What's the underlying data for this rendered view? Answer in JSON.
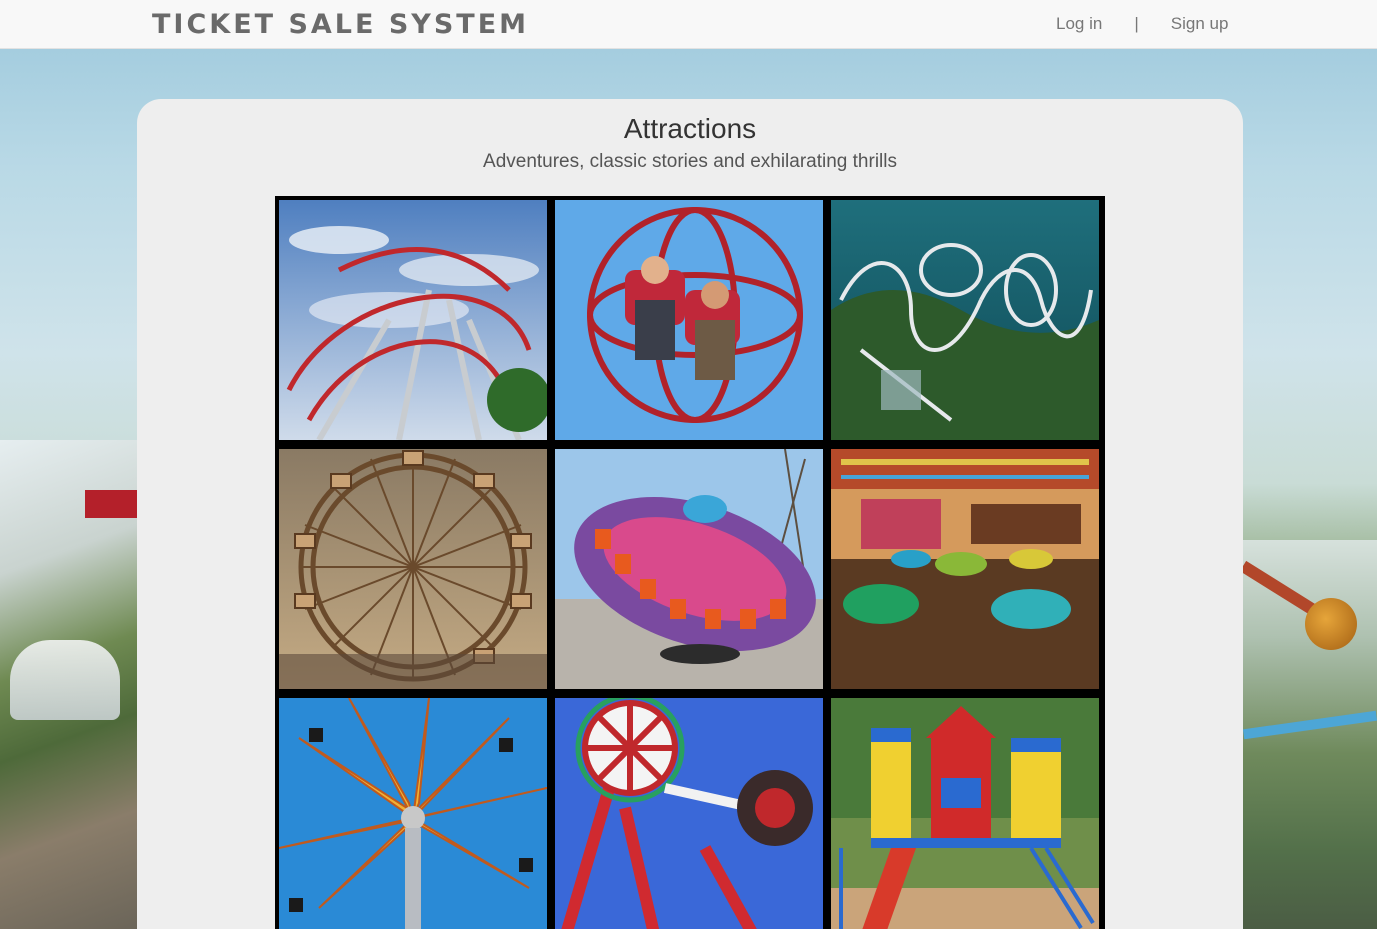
{
  "navbar": {
    "brand": "TICKET SALE SYSTEM",
    "login": "Log in",
    "separator": "|",
    "signup": "Sign up"
  },
  "section": {
    "title": "Attractions",
    "subtitle": "Adventures, classic stories and exhilarating thrills"
  },
  "attractions": [
    {
      "name": "looping-coaster",
      "icon": "roller-coaster-icon"
    },
    {
      "name": "gyro-sphere",
      "icon": "sphere-ride-icon"
    },
    {
      "name": "lakeside-coaster",
      "icon": "roller-coaster-icon"
    },
    {
      "name": "ferris-wheel",
      "icon": "ferris-wheel-icon"
    },
    {
      "name": "disk-ride",
      "icon": "disk-ride-icon"
    },
    {
      "name": "bumper-cars",
      "icon": "bumper-car-icon"
    },
    {
      "name": "star-flyer",
      "icon": "swing-ride-icon"
    },
    {
      "name": "pendulum-ride",
      "icon": "pendulum-icon"
    },
    {
      "name": "playground",
      "icon": "playground-icon"
    }
  ]
}
